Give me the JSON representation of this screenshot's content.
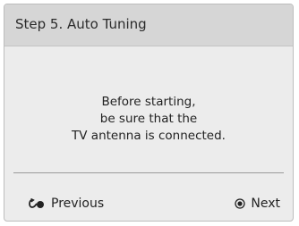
{
  "dialog": {
    "title": "Step 5. Auto Tuning",
    "message_lines": [
      "Before starting,",
      "be sure that the",
      "TV antenna is connected."
    ]
  },
  "footer": {
    "previous": {
      "label": "Previous",
      "icon": "return-icon"
    },
    "next": {
      "label": "Next",
      "icon": "ok-button-icon"
    }
  }
}
